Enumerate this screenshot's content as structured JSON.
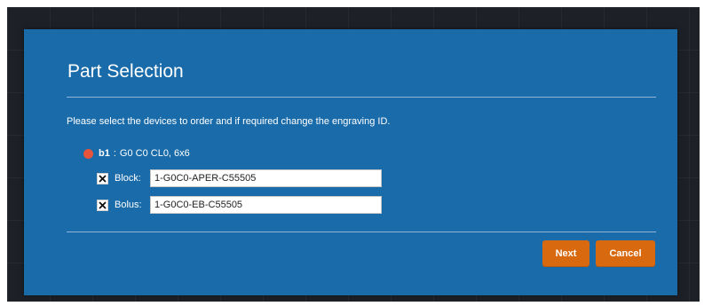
{
  "dialog": {
    "title": "Part Selection",
    "instruction": "Please select the devices to order and if required change the engraving ID."
  },
  "device": {
    "id": "b1",
    "separator": ":",
    "description": "G0 C0 CL0, 6x6",
    "status_color": "#e8533c"
  },
  "parts": [
    {
      "label": "Block:",
      "checked": true,
      "value": "1-G0C0-APER-C55505"
    },
    {
      "label": "Bolus:",
      "checked": true,
      "value": "1-G0C0-EB-C55505"
    }
  ],
  "buttons": {
    "next_label": "Next",
    "cancel_label": "Cancel"
  },
  "colors": {
    "dialog_bg": "#1a6baa",
    "button_bg": "#d9690f"
  },
  "icons": {
    "checkbox": "checkbox-checked-icon",
    "status": "status-dot-icon"
  }
}
